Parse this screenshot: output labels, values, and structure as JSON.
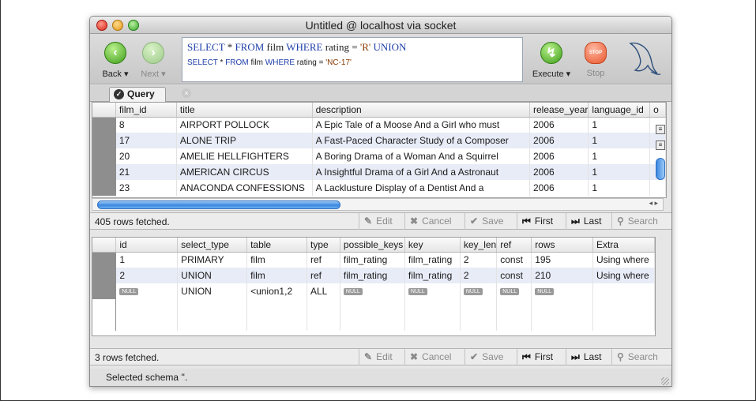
{
  "window": {
    "title": "Untitled @ localhost via socket"
  },
  "toolbar": {
    "back_label": "Back",
    "next_label": "Next",
    "execute_label": "Execute",
    "stop_label": "Stop",
    "stop_badge": "STOP",
    "query_line1": {
      "kw1": "SELECT",
      "star": "*",
      "kw2": "FROM",
      "tbl": "film",
      "kw3": "WHERE",
      "cond": "rating =",
      "val": "'R'",
      "kw4": "UNION"
    },
    "query_line2": {
      "kw1": "SELECT",
      "star": "*",
      "kw2": "FROM",
      "tbl": "film",
      "kw3": "WHERE",
      "cond": "rating =",
      "val": "'NC-17'"
    }
  },
  "tabs": [
    {
      "label": "Query"
    }
  ],
  "results": {
    "columns": [
      "film_id",
      "title",
      "description",
      "release_year",
      "language_id",
      "o"
    ],
    "rows": [
      [
        "8",
        "AIRPORT POLLOCK",
        "A Epic Tale of a Moose And a Girl who must",
        "2006",
        "1"
      ],
      [
        "17",
        "ALONE TRIP",
        "A Fast-Paced Character Study of a Composer",
        "2006",
        "1"
      ],
      [
        "20",
        "AMELIE HELLFIGHTERS",
        "A Boring Drama of a Woman And a Squirrel",
        "2006",
        "1"
      ],
      [
        "21",
        "AMERICAN CIRCUS",
        "A Insightful Drama of a Girl And a Astronaut",
        "2006",
        "1"
      ],
      [
        "23",
        "ANACONDA CONFESSIONS",
        "A Lacklusture Display of a Dentist And a",
        "2006",
        "1"
      ]
    ],
    "status": "405 rows fetched."
  },
  "explain": {
    "columns": [
      "id",
      "select_type",
      "table",
      "type",
      "possible_keys",
      "key",
      "key_len",
      "ref",
      "rows",
      "Extra"
    ],
    "rows": [
      [
        "1",
        "PRIMARY",
        "film",
        "ref",
        "film_rating",
        "film_rating",
        "2",
        "const",
        "195",
        "Using where"
      ],
      [
        "2",
        "UNION",
        "film",
        "ref",
        "film_rating",
        "film_rating",
        "2",
        "const",
        "210",
        "Using where"
      ],
      [
        "NULL",
        "UNION",
        "<union1,2",
        "ALL",
        "NULL",
        "NULL",
        "NULL",
        "NULL",
        "NULL",
        ""
      ]
    ],
    "status": "3 rows fetched."
  },
  "actions": {
    "edit": "Edit",
    "cancel": "Cancel",
    "save": "Save",
    "first": "First",
    "last": "Last",
    "search": "Search"
  },
  "footer": {
    "status": "Selected schema ''."
  }
}
